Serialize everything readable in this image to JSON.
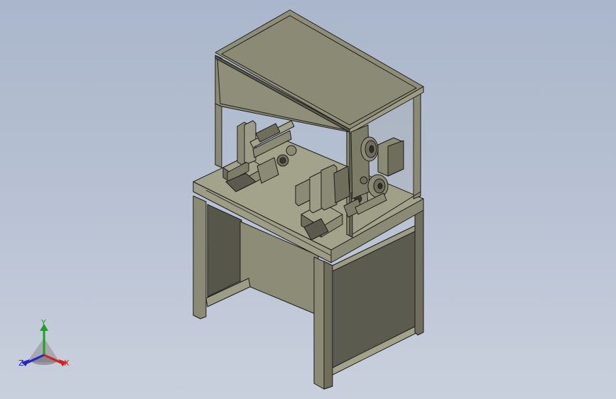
{
  "viewport": {
    "background_top": "#aab6cb",
    "background_bottom": "#c9d0dd",
    "model_fill": "#8b8a74",
    "model_fill_dark": "#6f6e5c",
    "model_fill_light": "#a3a28b",
    "edge_color": "#1e1e1a"
  },
  "triad": {
    "x_label": "X",
    "y_label": "Y",
    "z_label": "Z",
    "x_color": "#d42020",
    "y_color": "#1aa51a",
    "z_color": "#2424d0"
  }
}
